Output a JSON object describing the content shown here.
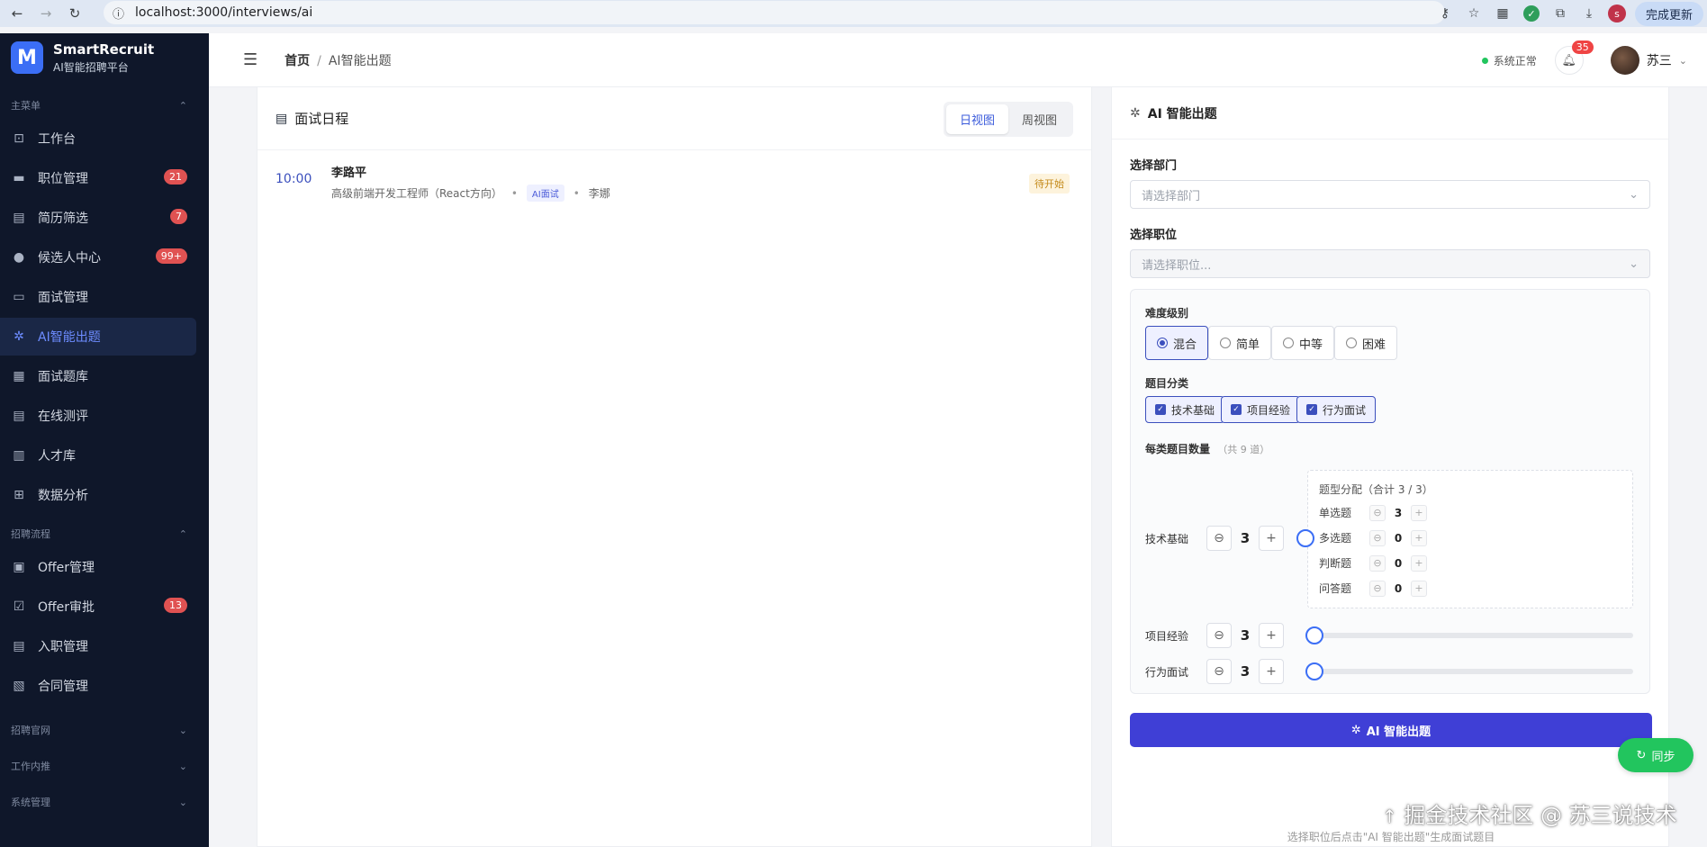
{
  "browser": {
    "url": "localhost:3000/interviews/ai",
    "update_label": "完成更新",
    "profile_initial": "s"
  },
  "sidebar": {
    "brand_name": "SmartRecruit",
    "brand_sub": "AI智能招聘平台",
    "logo_letter": "M",
    "group_main": "主菜单",
    "main_items": [
      {
        "label": "工作台",
        "icon": "workbench-icon",
        "badge": ""
      },
      {
        "label": "职位管理",
        "icon": "briefcase-icon",
        "badge": "21"
      },
      {
        "label": "简历筛选",
        "icon": "resume-icon",
        "badge": "7"
      },
      {
        "label": "候选人中心",
        "icon": "user-icon",
        "badge": "99+"
      },
      {
        "label": "面试管理",
        "icon": "video-icon",
        "badge": ""
      },
      {
        "label": "AI智能出题",
        "icon": "sparkle-icon",
        "badge": ""
      },
      {
        "label": "面试题库",
        "icon": "question-bank-icon",
        "badge": ""
      },
      {
        "label": "在线测评",
        "icon": "assessment-icon",
        "badge": ""
      },
      {
        "label": "人才库",
        "icon": "talent-pool-icon",
        "badge": ""
      },
      {
        "label": "数据分析",
        "icon": "chart-icon",
        "badge": ""
      }
    ],
    "group_flow": "招聘流程",
    "flow_items": [
      {
        "label": "Offer管理",
        "icon": "offer-icon",
        "badge": ""
      },
      {
        "label": "Offer审批",
        "icon": "approval-icon",
        "badge": "13"
      },
      {
        "label": "入职管理",
        "icon": "onboard-icon",
        "badge": ""
      },
      {
        "label": "合同管理",
        "icon": "contract-icon",
        "badge": ""
      }
    ],
    "group_site": "招聘官网",
    "group_referral": "工作内推",
    "group_system": "系统管理"
  },
  "header": {
    "breadcrumb_home": "首页",
    "breadcrumb_sep": "/",
    "breadcrumb_current": "AI智能出题",
    "system_status": "系统正常",
    "notifications": "35",
    "user_name": "苏三"
  },
  "schedule": {
    "title": "面试日程",
    "view_day": "日视图",
    "view_week": "周视图",
    "items": [
      {
        "time": "10:00",
        "name": "李路平",
        "position": "高级前端开发工程师（React方向）",
        "type": "AI面试",
        "interviewer": "李娜",
        "status": "待开始"
      }
    ]
  },
  "ai_panel": {
    "title": "AI 智能出题",
    "dept_label": "选择部门",
    "dept_placeholder": "请选择部门",
    "job_label": "选择职位",
    "job_placeholder": "请选择职位...",
    "difficulty_label": "难度级别",
    "difficulty_options": [
      "混合",
      "简单",
      "中等",
      "困难"
    ],
    "difficulty_selected": "混合",
    "category_label": "题目分类",
    "categories": [
      "技术基础",
      "项目经验",
      "行为面试"
    ],
    "count_label": "每类题目数量",
    "count_total": "（共 9 道）",
    "rows": [
      {
        "label": "技术基础",
        "value": "3",
        "slider_fraction": 0.0
      },
      {
        "label": "项目经验",
        "value": "3",
        "slider_fraction": 0.0
      },
      {
        "label": "行为面试",
        "value": "3",
        "slider_fraction": 0.0
      }
    ],
    "distribution_title": "题型分配（合计 3 / 3）",
    "distribution": [
      {
        "label": "单选题",
        "value": "3"
      },
      {
        "label": "多选题",
        "value": "0"
      },
      {
        "label": "判断题",
        "value": "0"
      },
      {
        "label": "问答题",
        "value": "0"
      }
    ],
    "generate_label": "AI 智能出题",
    "hint": "选择职位后点击\"AI 智能出题\"生成面试题目"
  },
  "sync_label": "同步",
  "credit": "掘金技术社区 @ 苏三说技术",
  "colors": {
    "sidebar_bg": "#0f172a",
    "accent": "#3f3fd6",
    "sync": "#22c55e"
  }
}
